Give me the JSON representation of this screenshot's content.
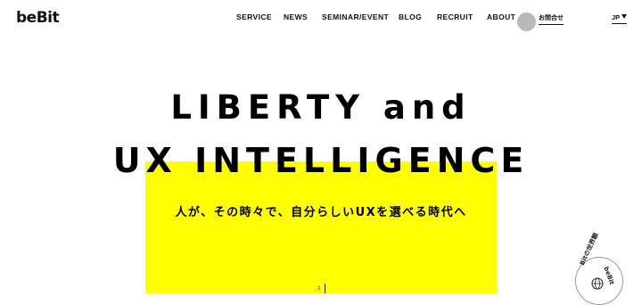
{
  "header": {
    "logo": "beBit",
    "nav": [
      "SERVICE",
      "NEWS",
      "SEMINAR/EVENT",
      "BLOG",
      "RECRUIT",
      "ABOUT"
    ],
    "contact": "お問合せ",
    "lang": "JP"
  },
  "hero": {
    "headline_line1": "LIBERTY and",
    "headline_line2": "UX INTELLIGENCE",
    "subheadline": "人が、その時々で、自分らしいUXを選べる時代へ",
    "scroll_label": "ス",
    "accent_color": "#ffff00"
  },
  "badge": {
    "text_left": "Bitの世界観",
    "text_right": "beBit"
  }
}
